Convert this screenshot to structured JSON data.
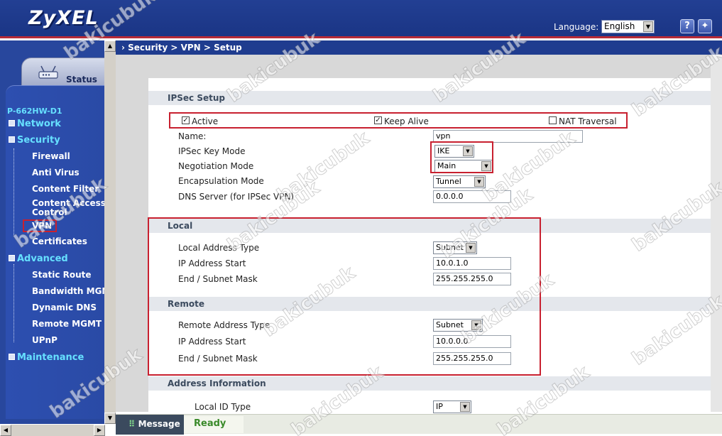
{
  "header": {
    "logo": "ZyXEL",
    "language_label": "Language:",
    "language_value": "English",
    "help_icon_glyph": "?",
    "wizard_icon_glyph": "✦"
  },
  "sidebar": {
    "status_label": "Status",
    "device_name": "P-662HW-D1",
    "items": [
      {
        "label": "Network"
      },
      {
        "label": "Security"
      },
      {
        "label": "Firewall"
      },
      {
        "label": "Anti Virus"
      },
      {
        "label": "Content Filter"
      },
      {
        "label": "Content Access"
      },
      {
        "label": "Control"
      },
      {
        "label": "VPN"
      },
      {
        "label": "Certificates"
      },
      {
        "label": "Advanced"
      },
      {
        "label": "Static Route"
      },
      {
        "label": "Bandwidth MGM"
      },
      {
        "label": "Dynamic DNS"
      },
      {
        "label": "Remote MGMT"
      },
      {
        "label": "UPnP"
      },
      {
        "label": "Maintenance"
      }
    ]
  },
  "breadcrumb": "Security > VPN > Setup",
  "ipsec": {
    "heading": "IPSec Setup",
    "active_label": "Active",
    "keepalive_label": "Keep Alive",
    "nat_label": "NAT Traversal",
    "name_label": "Name:",
    "name_value": "vpn",
    "keymode_label": "IPSec Key Mode",
    "keymode_value": "IKE",
    "negotiation_label": "Negotiation Mode",
    "negotiation_value": "Main",
    "encap_label": "Encapsulation Mode",
    "encap_value": "Tunnel",
    "dns_label": "DNS Server (for IPSec VPN)",
    "dns_value": "0.0.0.0"
  },
  "local": {
    "heading": "Local",
    "type_label": "Local Address Type",
    "type_value": "Subnet",
    "start_label": "IP Address Start",
    "start_value": "10.0.1.0",
    "mask_label": "End / Subnet Mask",
    "mask_value": "255.255.255.0"
  },
  "remote": {
    "heading": "Remote",
    "type_label": "Remote Address Type",
    "type_value": "Subnet",
    "start_label": "IP Address Start",
    "start_value": "10.0.0.0",
    "mask_label": "End / Subnet Mask",
    "mask_value": "255.255.255.0"
  },
  "address_info": {
    "heading": "Address Information",
    "local_id_label": "Local ID Type",
    "local_id_value": "IP"
  },
  "statusbar": {
    "message_label": "Message",
    "status_value": "Ready"
  },
  "watermark": "bakicubuk",
  "colors": {
    "header_bg": "#1f3c8f",
    "header_accent": "#b72b37",
    "sidebar_bg": "#28479d",
    "highlight_box": "#c8202f",
    "ready_text": "#3a8a2a"
  }
}
